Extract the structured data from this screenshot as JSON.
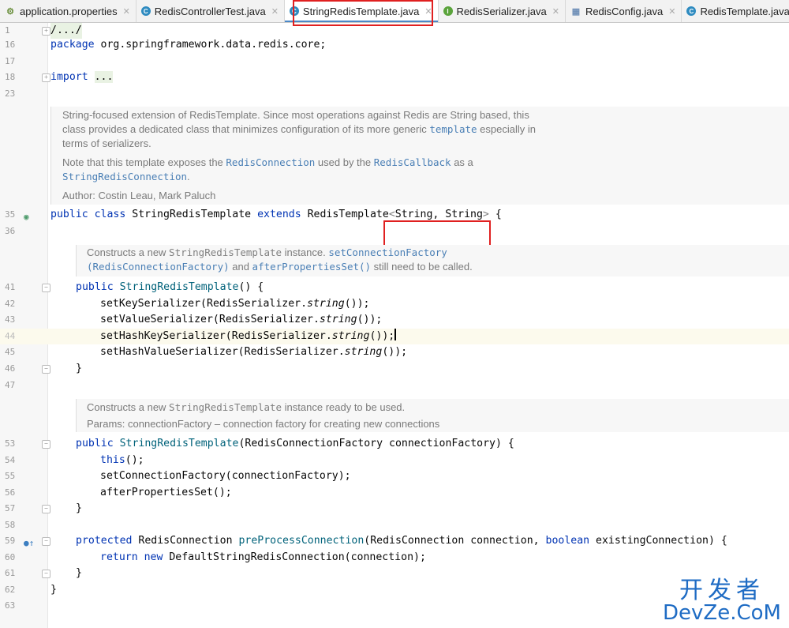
{
  "tabs": [
    {
      "label": "application.properties",
      "icon": "properties-file-icon",
      "active": false
    },
    {
      "label": "RedisControllerTest.java",
      "icon": "class-icon",
      "active": false
    },
    {
      "label": "StringRedisTemplate.java",
      "icon": "class-icon",
      "active": true
    },
    {
      "label": "RedisSerializer.java",
      "icon": "interface-icon",
      "active": false
    },
    {
      "label": "RedisConfig.java",
      "icon": "config-file-icon",
      "active": false
    },
    {
      "label": "RedisTemplate.java",
      "icon": "class-icon",
      "active": false
    }
  ],
  "line_numbers": {
    "l1": "1",
    "l16": "16",
    "l17": "17",
    "l18": "18",
    "l23": "23",
    "l35": "35",
    "l36": "36",
    "l41": "41",
    "l42": "42",
    "l43": "43",
    "l44": "44",
    "l45": "45",
    "l46": "46",
    "l47": "47",
    "l53": "53",
    "l54": "54",
    "l55": "55",
    "l56": "56",
    "l57": "57",
    "l58": "58",
    "l59": "59",
    "l60": "60",
    "l61": "61",
    "l62": "62",
    "l63": "63"
  },
  "code": {
    "header_fold": "/.../",
    "pkg_kw": "package",
    "pkg_name": " org.springframework.data.redis.core;",
    "import_kw": "import",
    "import_fold": "...",
    "class_public": "public",
    "class_kw": "class",
    "class_name": "StringRedisTemplate",
    "class_extends": "extends",
    "class_super": "RedisTemplate",
    "class_generic_open": "<",
    "class_generic_args": "String, String",
    "class_generic_close": ">",
    "class_brace": " {",
    "ctor1_public": "public",
    "ctor1_name": "StringRedisTemplate",
    "ctor1_rest": "() {",
    "l42_call": "setKeySerializer",
    "l43_call": "setValueSerializer",
    "l44_call": "setHashKeySerializer",
    "l45_call": "setHashValueSerializer",
    "ser_class": "RedisSerializer.",
    "ser_method": "string",
    "ser_tail": "());",
    "close_brace": "}",
    "ctor2_public": "public",
    "ctor2_name": "StringRedisTemplate",
    "ctor2_params": "(RedisConnectionFactory connectionFactory) {",
    "l54_this": "this",
    "l54_tail": "();",
    "l55_call": "setConnectionFactory",
    "l55_args": "(connectionFactory);",
    "l56_call": "afterPropertiesSet",
    "l56_args": "();",
    "m3_protected": "protected",
    "m3_type": "RedisConnection",
    "m3_name": "preProcessConnection",
    "m3_params_a": "(RedisConnection connection, ",
    "m3_boolean": "boolean",
    "m3_params_b": " existingConnection) {",
    "l60_return": "return",
    "l60_new": "new",
    "l60_rest": " DefaultStringRedisConnection(connection);"
  },
  "doc_class": {
    "p1_l1": "String-focused extension of RedisTemplate. Since most operations against Redis are String based, this",
    "p1_l2a": "class provides a dedicated class that minimizes configuration of its more generic ",
    "p1_l2_link": "template",
    "p1_l2b": " especially in",
    "p1_l3": "terms of serializers.",
    "p2_a": "Note that this template exposes the ",
    "p2_link1": "RedisConnection",
    "p2_b": " used by the ",
    "p2_link2": "RedisCallback",
    "p2_c": " as a",
    "p2_link3": "StringRedisConnection",
    "p2_d": ".",
    "author": "Author: Costin Leau, Mark Paluch"
  },
  "doc_ctor1": {
    "a": "Constructs a new ",
    "mono": "StringRedisTemplate",
    "b": " instance. ",
    "link1": "setConnectionFactory",
    "link2": "(RedisConnectionFactory)",
    "c": " and ",
    "link3": "afterPropertiesSet()",
    "d": " still need to be called."
  },
  "doc_ctor2": {
    "a": "Constructs a new ",
    "mono": "StringRedisTemplate",
    "b": " instance ready to be used.",
    "params": "Params: connectionFactory – connection factory for creating new connections"
  },
  "watermark": {
    "line1": "开发者",
    "line2": "DevZe.CoM"
  }
}
